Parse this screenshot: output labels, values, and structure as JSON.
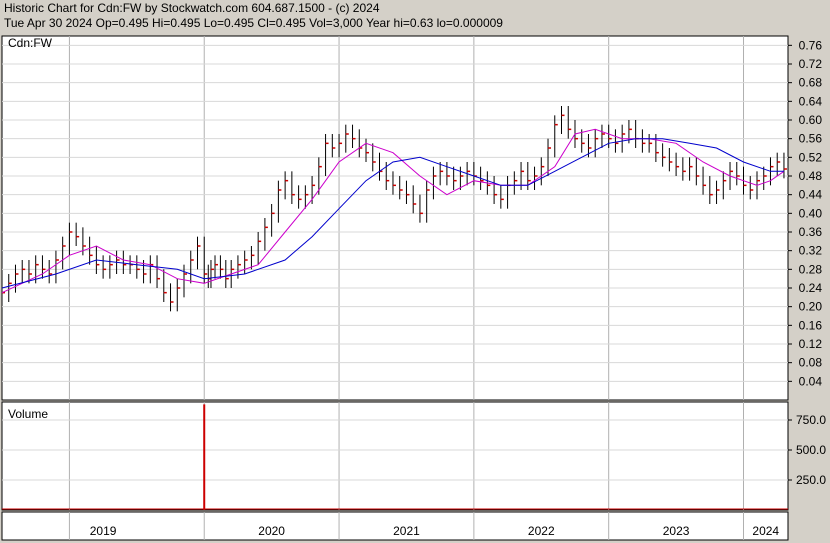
{
  "header": {
    "title": "Historic Chart for Cdn:FW by Stockwatch.com 604.687.1500 - (c) 2024",
    "ohlc": "Tue Apr 30 2024   Op=0.495   Hi=0.495   Lo=0.495   Cl=0.495   Vol=3,000   Year hi=0.63   lo=0.000009"
  },
  "chart_data": [
    {
      "type": "line",
      "panel": "price",
      "label": "Cdn:FW",
      "ylim": [
        0,
        0.78
      ],
      "y_ticks": [
        "0.76",
        "0.72",
        "0.68",
        "0.64",
        "0.60",
        "0.56",
        "0.52",
        "0.48",
        "0.44",
        "0.40",
        "0.36",
        "0.32",
        "0.28",
        "0.24",
        "0.20",
        "0.16",
        "0.12",
        "0.08",
        "0.04"
      ],
      "grid": true,
      "colors": {
        "price": "#000000",
        "marker": "#cc0000",
        "ma_short": "#cc00cc",
        "ma_long": "#0000cc"
      },
      "series": [
        {
          "key": "price",
          "x": [
            2018.5,
            2018.55,
            2018.6,
            2018.65,
            2018.7,
            2018.75,
            2018.8,
            2018.85,
            2018.9,
            2018.95,
            2019.0,
            2019.05,
            2019.1,
            2019.15,
            2019.2,
            2019.25,
            2019.3,
            2019.35,
            2019.4,
            2019.45,
            2019.5,
            2019.55,
            2019.6,
            2019.65,
            2019.7,
            2019.75,
            2019.8,
            2019.85,
            2019.9,
            2019.95,
            2020.0,
            2020.03,
            2020.05,
            2020.08,
            2020.12,
            2020.16,
            2020.2,
            2020.25,
            2020.3,
            2020.35,
            2020.4,
            2020.45,
            2020.5,
            2020.55,
            2020.6,
            2020.65,
            2020.7,
            2020.75,
            2020.8,
            2020.85,
            2020.9,
            2020.95,
            2021.0,
            2021.05,
            2021.1,
            2021.15,
            2021.2,
            2021.25,
            2021.3,
            2021.35,
            2021.4,
            2021.45,
            2021.5,
            2021.55,
            2021.6,
            2021.65,
            2021.7,
            2021.75,
            2021.8,
            2021.85,
            2021.9,
            2021.95,
            2022.0,
            2022.05,
            2022.1,
            2022.15,
            2022.2,
            2022.25,
            2022.3,
            2022.35,
            2022.4,
            2022.45,
            2022.5,
            2022.55,
            2022.6,
            2022.65,
            2022.7,
            2022.75,
            2022.8,
            2022.85,
            2022.9,
            2022.95,
            2023.0,
            2023.05,
            2023.1,
            2023.15,
            2023.2,
            2023.25,
            2023.3,
            2023.35,
            2023.4,
            2023.45,
            2023.5,
            2023.55,
            2023.6,
            2023.65,
            2023.7,
            2023.75,
            2023.8,
            2023.85,
            2023.9,
            2023.95,
            2024.0,
            2024.05,
            2024.1,
            2024.15,
            2024.2,
            2024.25,
            2024.3
          ],
          "y": [
            0.23,
            0.25,
            0.27,
            0.28,
            0.27,
            0.29,
            0.28,
            0.27,
            0.3,
            0.33,
            0.36,
            0.35,
            0.33,
            0.31,
            0.29,
            0.28,
            0.29,
            0.3,
            0.29,
            0.29,
            0.28,
            0.27,
            0.29,
            0.26,
            0.23,
            0.21,
            0.24,
            0.27,
            0.3,
            0.33,
            0.27,
            0.26,
            0.28,
            0.29,
            0.28,
            0.26,
            0.28,
            0.29,
            0.3,
            0.31,
            0.34,
            0.37,
            0.4,
            0.45,
            0.47,
            0.44,
            0.43,
            0.44,
            0.46,
            0.5,
            0.55,
            0.54,
            0.55,
            0.57,
            0.56,
            0.54,
            0.53,
            0.51,
            0.49,
            0.47,
            0.46,
            0.45,
            0.44,
            0.42,
            0.4,
            0.45,
            0.48,
            0.49,
            0.48,
            0.47,
            0.48,
            0.49,
            0.48,
            0.47,
            0.46,
            0.44,
            0.43,
            0.46,
            0.47,
            0.49,
            0.47,
            0.48,
            0.5,
            0.54,
            0.59,
            0.61,
            0.58,
            0.56,
            0.55,
            0.54,
            0.56,
            0.57,
            0.56,
            0.55,
            0.57,
            0.58,
            0.56,
            0.55,
            0.55,
            0.53,
            0.52,
            0.51,
            0.5,
            0.49,
            0.5,
            0.48,
            0.46,
            0.44,
            0.45,
            0.47,
            0.49,
            0.48,
            0.46,
            0.45,
            0.47,
            0.48,
            0.5,
            0.51,
            0.495
          ]
        },
        {
          "key": "ma_short",
          "x": [
            2018.5,
            2018.8,
            2019.0,
            2019.2,
            2019.4,
            2019.6,
            2019.8,
            2020.0,
            2020.2,
            2020.4,
            2020.6,
            2020.8,
            2020.9,
            2021.0,
            2021.2,
            2021.4,
            2021.6,
            2021.8,
            2022.0,
            2022.2,
            2022.4,
            2022.6,
            2022.75,
            2022.9,
            2023.1,
            2023.3,
            2023.5,
            2023.7,
            2023.9,
            2024.0,
            2024.1,
            2024.2,
            2024.3
          ],
          "y": [
            0.23,
            0.27,
            0.31,
            0.33,
            0.3,
            0.29,
            0.26,
            0.25,
            0.27,
            0.29,
            0.36,
            0.43,
            0.47,
            0.51,
            0.55,
            0.53,
            0.48,
            0.44,
            0.47,
            0.46,
            0.46,
            0.5,
            0.57,
            0.58,
            0.56,
            0.56,
            0.55,
            0.51,
            0.48,
            0.47,
            0.46,
            0.47,
            0.49
          ]
        },
        {
          "key": "ma_long",
          "x": [
            2018.5,
            2018.9,
            2019.2,
            2019.5,
            2019.8,
            2020.0,
            2020.3,
            2020.6,
            2020.8,
            2021.0,
            2021.2,
            2021.4,
            2021.6,
            2021.8,
            2022.0,
            2022.2,
            2022.4,
            2022.6,
            2022.8,
            2023.0,
            2023.2,
            2023.4,
            2023.6,
            2023.8,
            2024.0,
            2024.2,
            2024.3
          ],
          "y": [
            0.24,
            0.27,
            0.3,
            0.29,
            0.28,
            0.26,
            0.27,
            0.3,
            0.35,
            0.41,
            0.47,
            0.51,
            0.52,
            0.5,
            0.48,
            0.46,
            0.46,
            0.49,
            0.52,
            0.55,
            0.56,
            0.56,
            0.55,
            0.54,
            0.51,
            0.49,
            0.49
          ]
        }
      ]
    },
    {
      "type": "bar",
      "panel": "volume",
      "label": "Volume",
      "ylim": [
        0,
        900
      ],
      "y_ticks": [
        "750.0",
        "500.0",
        "250.0"
      ],
      "x_ticks": [
        "2019",
        "2020",
        "2021",
        "2022",
        "2023",
        "2024"
      ],
      "colors": {
        "bar": "#cc0000"
      },
      "x": [
        2020.0
      ],
      "values": [
        880
      ]
    }
  ]
}
